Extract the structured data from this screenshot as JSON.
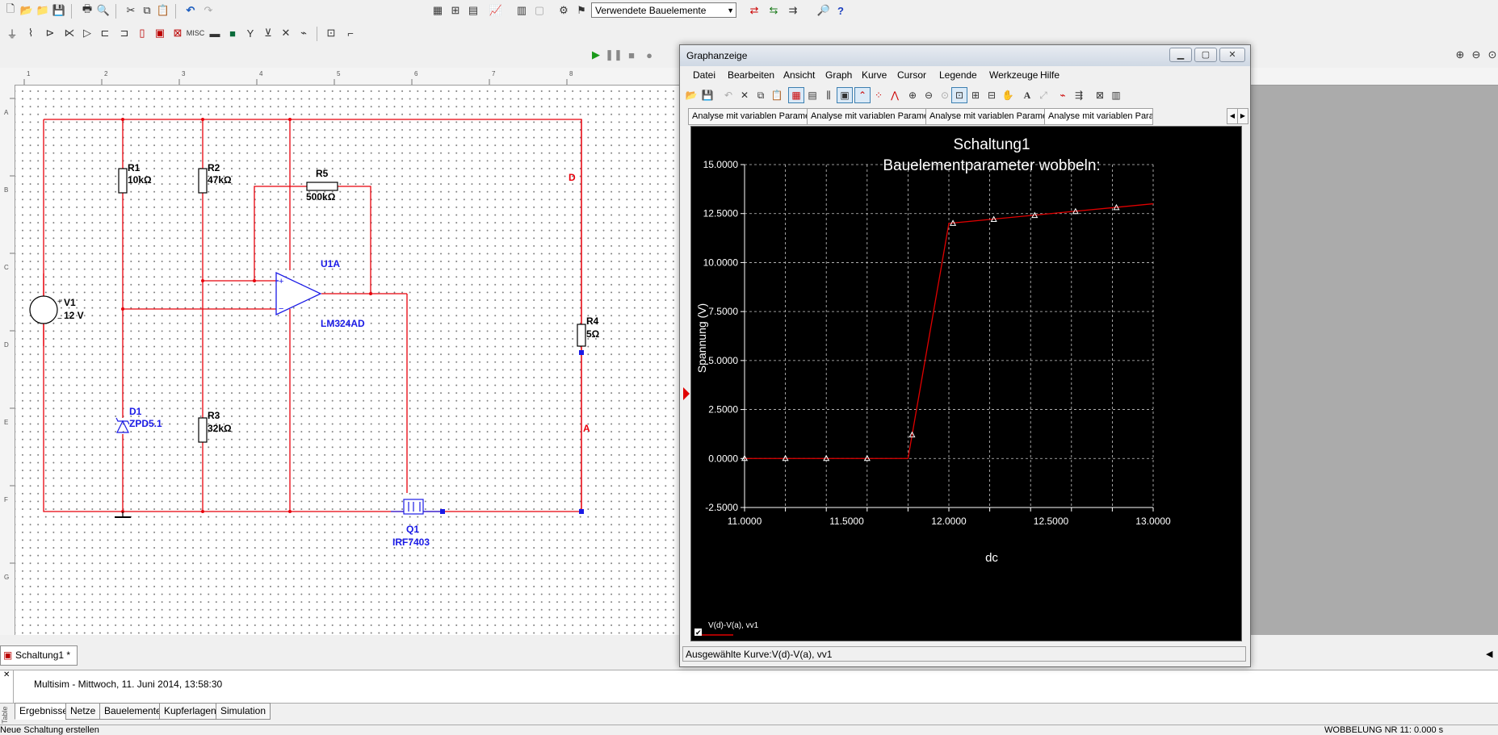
{
  "toolbar": {
    "components_combo": "Verwendete Bauelemente"
  },
  "schematic": {
    "components": [
      {
        "ref": "R1",
        "value": "10kΩ"
      },
      {
        "ref": "R2",
        "value": "47kΩ"
      },
      {
        "ref": "R5",
        "value": "500kΩ"
      },
      {
        "ref": "U1A",
        "value": "LM324AD"
      },
      {
        "ref": "V1",
        "value": "12 V"
      },
      {
        "ref": "R4",
        "value": "5Ω"
      },
      {
        "ref": "D1",
        "value": "ZPD5.1"
      },
      {
        "ref": "R3",
        "value": "32kΩ"
      },
      {
        "ref": "Q1",
        "value": "IRF7403"
      }
    ],
    "nodes": {
      "d": "D",
      "a": "A"
    },
    "ruler_top": [
      "1",
      "2",
      "3",
      "4",
      "5",
      "6",
      "7",
      "8"
    ],
    "ruler_left": [
      "A",
      "B",
      "C",
      "D",
      "E",
      "F",
      "G"
    ],
    "colors": {
      "wire": "#e8000b",
      "part": "#1a1ae6"
    }
  },
  "document_tab": "Schaltung1 *",
  "output_message": "Multisim  -  Mittwoch, 11. Juni 2014, 13:58:30",
  "bottom_tabs": [
    "Ergebnisse",
    "Netze",
    "Bauelemente",
    "Kupferlagen",
    "Simulation"
  ],
  "side_label": "Table",
  "status": {
    "left": "Neue Schaltung erstellen",
    "right": "WOBBELUNG NR 11: 0.000 s"
  },
  "graph_window": {
    "title": "Graphanzeige",
    "menu": [
      "Datei",
      "Bearbeiten",
      "Ansicht",
      "Graph",
      "Kurve",
      "Cursor",
      "Legende",
      "Werkzeuge",
      "Hilfe"
    ],
    "tabs": [
      "Analyse mit variablen Parametern",
      "Analyse mit variablen Parametern",
      "Analyse mit variablen Parametern",
      "Analyse mit variablen Para"
    ],
    "status_text": "Ausgewählte Kurve:V(d)-V(a), vv1",
    "legend_label": "V(d)-V(a), vv1"
  },
  "chart_data": {
    "type": "line",
    "title": "Schaltung1",
    "subtitle": "Bauelementparameter wobbeln:",
    "xlabel": "dc",
    "ylabel": "Spannung (V)",
    "xlim": [
      11.0,
      13.0
    ],
    "ylim": [
      -2.5,
      15.0
    ],
    "xticks": [
      "11.0000",
      "11.5000",
      "12.0000",
      "12.5000",
      "13.0000"
    ],
    "yticks": [
      "-2.5000",
      "0.0000",
      "2.5000",
      "5.0000",
      "7.5000",
      "10.0000",
      "12.5000",
      "15.0000"
    ],
    "grid": true,
    "legend_placement": "bottom-left",
    "series": [
      {
        "name": "V(d)-V(a), vv1",
        "color": "#e00000",
        "x": [
          11.0,
          11.2,
          11.4,
          11.6,
          11.8,
          12.0,
          12.2,
          12.4,
          12.6,
          12.8,
          13.0
        ],
        "y": [
          0.0,
          0.0,
          0.0,
          0.0,
          0.0,
          12.0,
          12.2,
          12.4,
          12.6,
          12.8,
          13.0
        ],
        "markers_x": [
          11.0,
          11.2,
          11.4,
          11.6,
          11.82,
          12.02,
          12.22,
          12.42,
          12.62,
          12.82
        ],
        "markers_y": [
          0.0,
          0.0,
          0.0,
          0.0,
          1.2,
          12.0,
          12.2,
          12.4,
          12.6,
          12.8
        ]
      }
    ]
  }
}
